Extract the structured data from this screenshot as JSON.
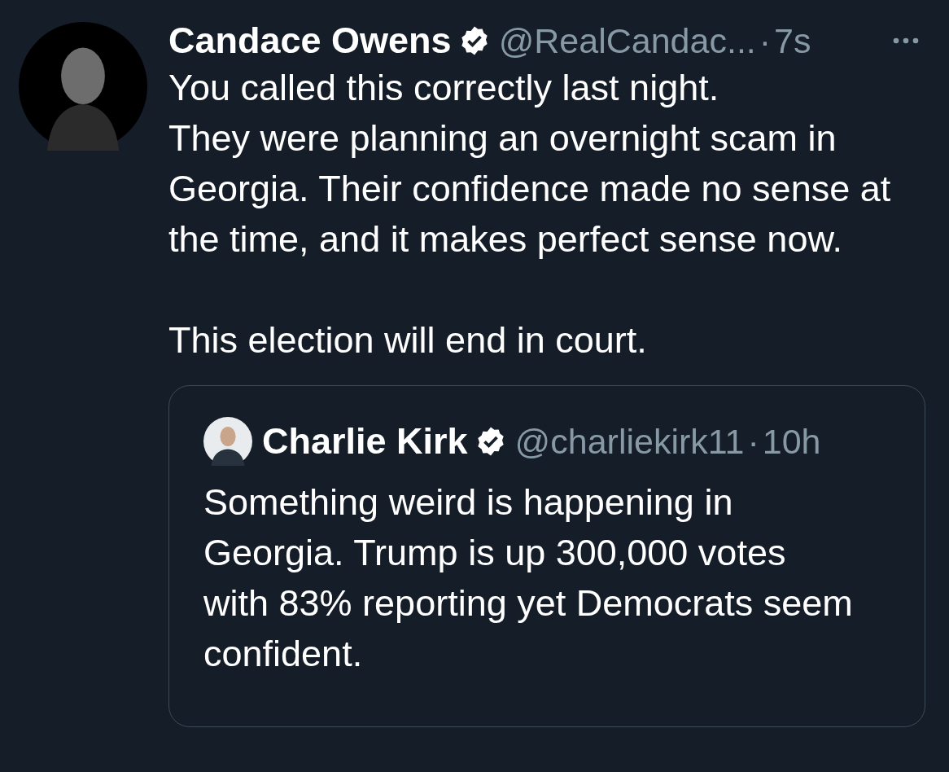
{
  "tweet": {
    "author": {
      "name": "Candace Owens",
      "verified": true,
      "handle": "@RealCandac...",
      "separator": "·",
      "time": "7s"
    },
    "text": "You called this correctly last night.\nThey were planning an overnight scam in Georgia. Their confidence made no sense at the time, and it makes perfect sense now.\n\nThis election will end in court.",
    "quoted_tweet": {
      "author": {
        "name": "Charlie Kirk",
        "verified": true,
        "handle": "@charliekirk11",
        "separator": "·",
        "time": "10h"
      },
      "text": "Something weird is happening in Georgia. Trump is up 300,000 votes with 83% reporting yet Democrats seem confident."
    }
  }
}
